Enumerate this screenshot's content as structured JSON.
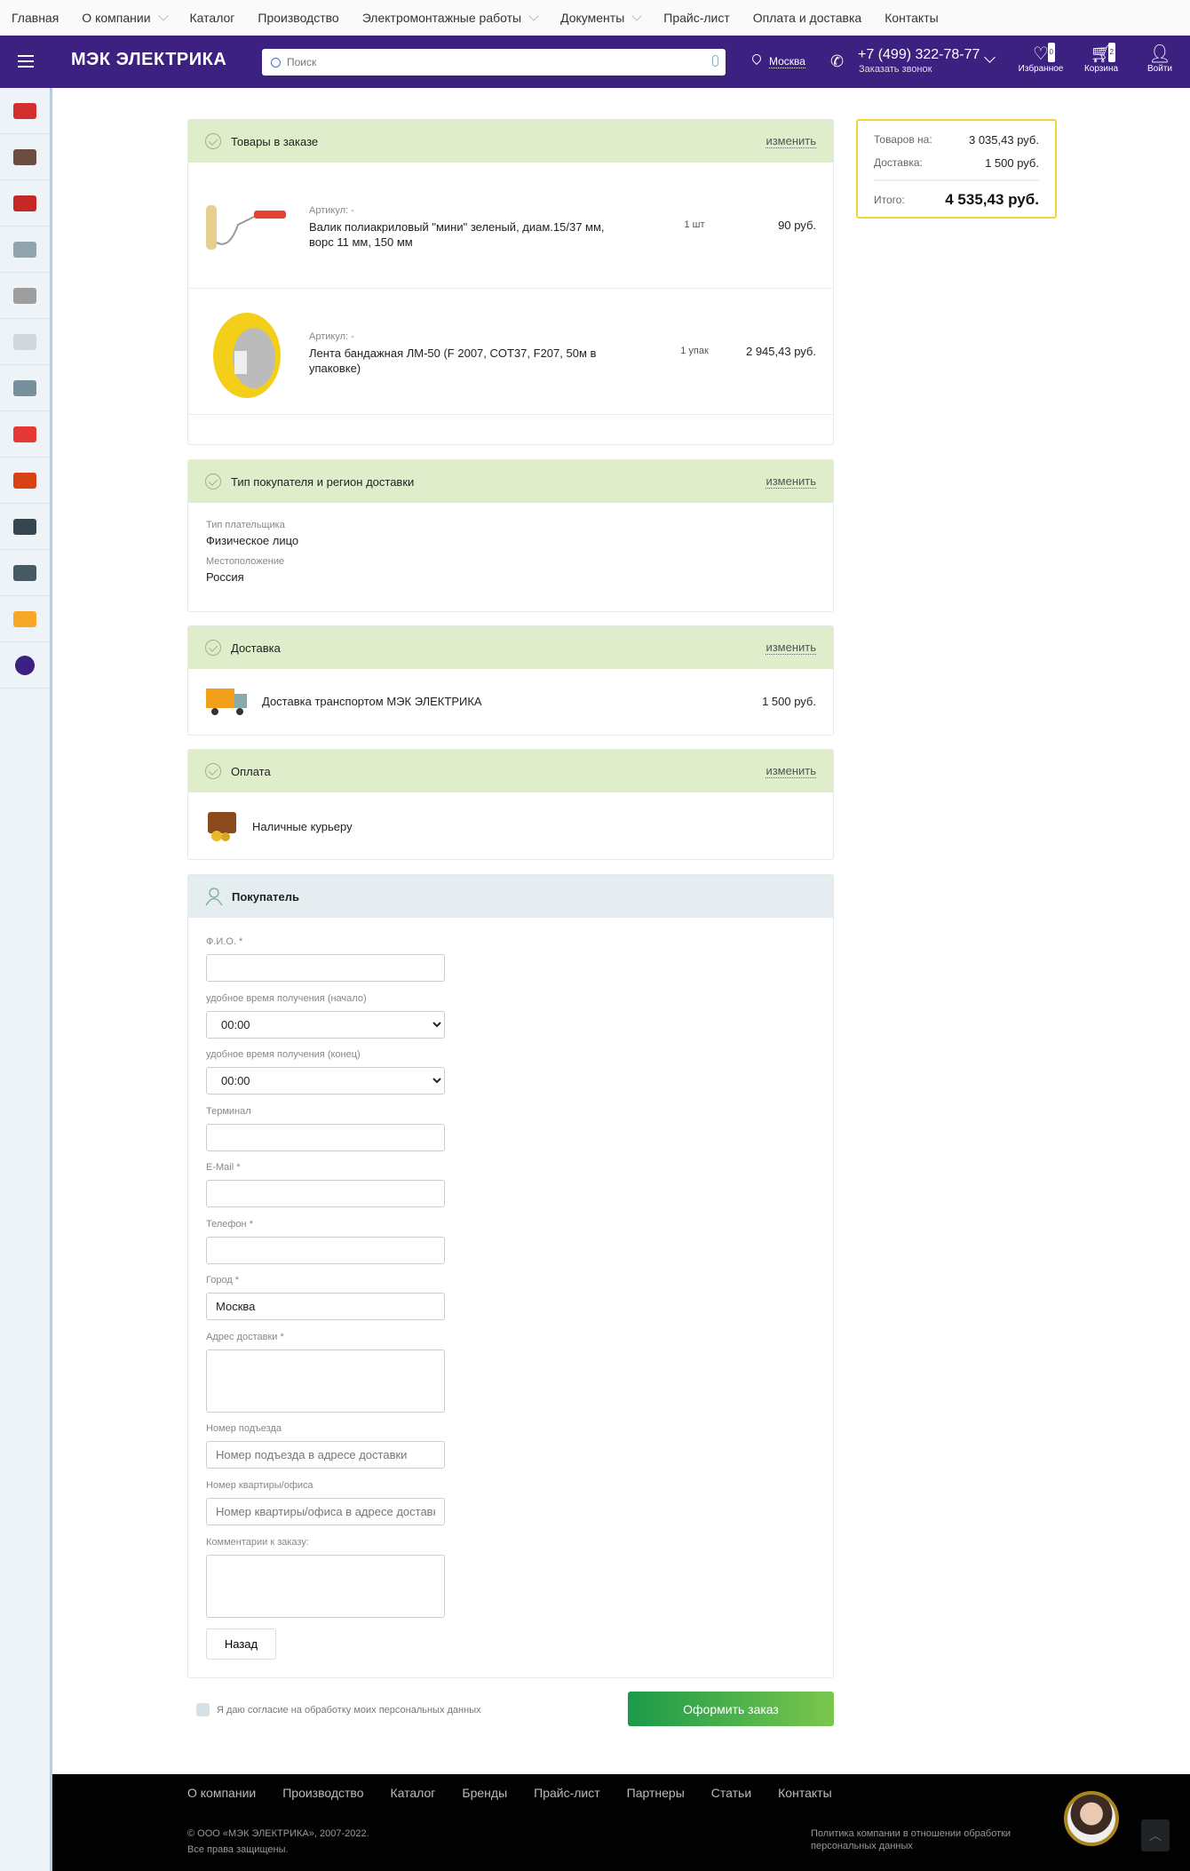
{
  "topnav": [
    "Главная",
    "О компании",
    "Каталог",
    "Производство",
    "Электромонтажные работы",
    "Документы",
    "Прайс-лист",
    "Оплата и доставка",
    "Контакты"
  ],
  "topnav_dropdowns": [
    false,
    true,
    false,
    false,
    true,
    true,
    false,
    false,
    false
  ],
  "header": {
    "logo": "МЭК ЭЛЕКТРИКА",
    "search_placeholder": "Поиск",
    "city": "Москва",
    "phone": "+7 (499) 322-78-77",
    "callback": "Заказать звонок",
    "favorites": "Избранное",
    "favorites_count": "0",
    "cart": "Корзина",
    "cart_count": "2",
    "login": "Войти",
    "brand_color": "#3c2180"
  },
  "order": {
    "title": "Товары в заказе",
    "edit": "изменить",
    "items": [
      {
        "article": "Артикул: -",
        "name": "Валик полиакриловый \"мини\" зеленый, диам.15/37 мм, ворс 11 мм, 150 мм",
        "qty": "1 шт",
        "price": "90 руб."
      },
      {
        "article": "Артикул: -",
        "name": "Лента бандажная ЛМ-50 (F 2007, COT37, F207, 50м в упаковке)",
        "qty": "1 упак",
        "price": "2 945,43 руб."
      }
    ]
  },
  "buyer_type": {
    "title": "Тип покупателя и регион доставки",
    "edit": "изменить",
    "payer_label": "Тип плательщика",
    "payer": "Физическое лицо",
    "location_label": "Местоположение",
    "location": "Россия"
  },
  "delivery": {
    "title": "Доставка",
    "edit": "изменить",
    "name": "Доставка транспортом МЭК ЭЛЕКТРИКА",
    "price": "1 500 руб."
  },
  "payment": {
    "title": "Оплата",
    "edit": "изменить",
    "name": "Наличные курьеру"
  },
  "buyer": {
    "title": "Покупатель",
    "fields": [
      {
        "label": "Ф.И.О. *",
        "value": "",
        "placeholder": ""
      },
      {
        "label": "удобное время получения (начало)",
        "value": "00:00"
      },
      {
        "label": "удобное время получения (конец)",
        "value": "00:00"
      },
      {
        "label": "Терминал",
        "value": "",
        "placeholder": ""
      },
      {
        "label": "E-Mail *",
        "value": "",
        "placeholder": ""
      },
      {
        "label": "Телефон *",
        "value": "",
        "placeholder": ""
      },
      {
        "label": "Город *",
        "value": "Москва",
        "placeholder": ""
      },
      {
        "label": "Адрес доставки *",
        "value": ""
      },
      {
        "label": "Номер подъезда",
        "value": "",
        "placeholder": "Номер подъезда в адресе доставки"
      },
      {
        "label": "Номер квартиры/офиса",
        "value": "",
        "placeholder": "Номер квартиры/офиса в адресе доставки"
      },
      {
        "label": "Комментарии к заказу:",
        "value": ""
      }
    ],
    "back": "Назад"
  },
  "summary": {
    "goods_label": "Товаров на:",
    "goods": "3 035,43 руб.",
    "delivery_label": "Доставка:",
    "delivery": "1 500 руб.",
    "total_label": "Итого:",
    "total": "4 535,43 руб."
  },
  "consent": "Я даю согласие на обработку моих персональных данных",
  "submit": "Оформить заказ",
  "footer": {
    "links": [
      "О компании",
      "Производство",
      "Каталог",
      "Бренды",
      "Прайс-лист",
      "Партнеры",
      "Статьи",
      "Контакты"
    ],
    "copyright": "© ООО «МЭК ЭЛЕКТРИКА», 2007-2022.",
    "rights": "Все права защищены.",
    "policy": "Политика компании в отношении обработки персональных данных"
  },
  "sidebar_colors": [
    "#d32f2f",
    "#6d4c41",
    "#c62828",
    "#90a4ae",
    "#9e9e9e",
    "#cfd8dc",
    "#78909c",
    "#e53935",
    "#d84315",
    "#37474f",
    "#455a64",
    "#f9a825",
    "#3c2180"
  ]
}
